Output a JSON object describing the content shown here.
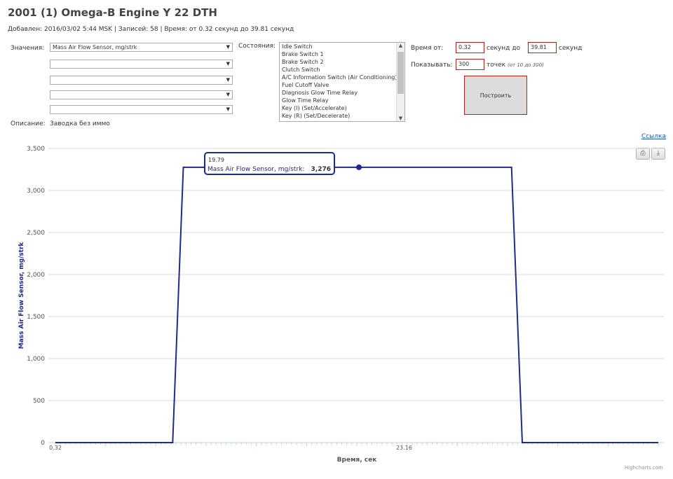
{
  "header": {
    "title": "2001 (1) Omega-B Engine Y 22 DTH",
    "meta": "Добавлен: 2016/03/02 5:44 MSK | Записей: 58 | Время: от 0.32 секунд до 39.81 секунд"
  },
  "form": {
    "values_label": "Значения:",
    "selects": [
      "Mass Air Flow Sensor, mg/strk",
      "",
      "",
      "",
      ""
    ],
    "states_label": "Состояния:",
    "states": [
      "Idle Switch",
      "Brake Switch 1",
      "Brake Switch 2",
      "Clutch Switch",
      "A/C Information Switch (Air Conditioning)",
      "Fuel Cutoff Valve",
      "Diagnosis Glow Time Relay",
      "Glow Time Relay",
      "Key (I) (Set/Accelerate)",
      "Key (R) (Set/Decelerate)"
    ],
    "time_from_label": "Время от:",
    "time_from": "0.32",
    "seconds_to": "секунд   до",
    "time_to": "39.81",
    "seconds": "секунд",
    "show_label": "Показывать:",
    "points": "300",
    "points_label": "точек",
    "points_hint": "(от 10 до 300)",
    "build_button": "Построить",
    "description_label": "Описание:",
    "description": "Заводка без иммо"
  },
  "link_label": "Ссылка",
  "credit": "Highcharts.com",
  "icons": {
    "print": "print-icon",
    "download": "download-icon"
  },
  "colors": {
    "series": "#1e2b8c",
    "grid": "#d8d8d8",
    "input_border": "#b22222"
  },
  "tooltip": {
    "x": "19.79",
    "series": "Mass Air Flow Sensor, mg/strk",
    "value": "3,276"
  },
  "chart_data": {
    "type": "line",
    "xlabel": "Время, сек",
    "ylabel": "Mass Air Flow Sensor, mg/strk",
    "xlim": [
      0.32,
      39.81
    ],
    "ylim": [
      0,
      3500
    ],
    "y_ticks": [
      0,
      500,
      1000,
      1500,
      2000,
      2500,
      3000,
      3500
    ],
    "y_tick_labels": [
      "0",
      "500",
      "1,000",
      "1,500",
      "2,000",
      "2,500",
      "3,000",
      "3,500"
    ],
    "x_tick_values": [
      0.32,
      23.16
    ],
    "x_tick_labels": [
      "0.32",
      "23.16"
    ],
    "grid": true,
    "series": [
      {
        "name": "Mass Air Flow Sensor, mg/strk",
        "x": [
          0.32,
          8.0,
          8.7,
          19.79,
          30.2,
          30.9,
          39.81
        ],
        "y": [
          0,
          0,
          3276,
          3276,
          3276,
          0,
          0
        ]
      }
    ]
  }
}
